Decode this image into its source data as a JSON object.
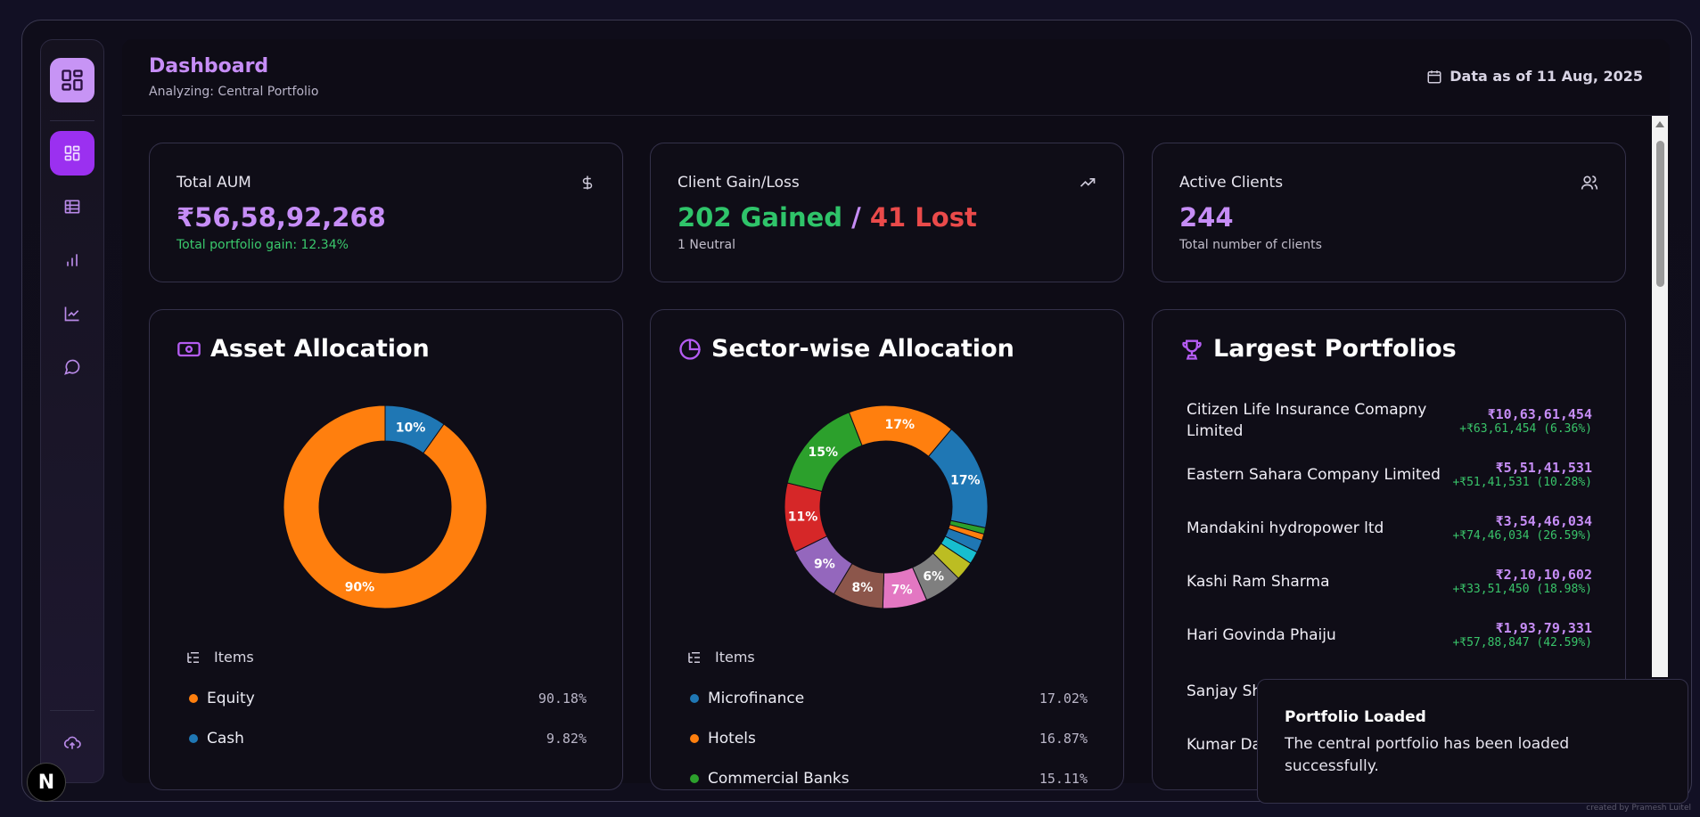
{
  "header": {
    "title": "Dashboard",
    "subtitle": "Analyzing: Central Portfolio",
    "date_label": "Data as of 11 Aug, 2025"
  },
  "sidebar": {
    "items": [
      {
        "icon": "dashboard-icon",
        "active": true
      },
      {
        "icon": "table-icon",
        "active": false
      },
      {
        "icon": "bar-chart-icon",
        "active": false
      },
      {
        "icon": "line-chart-icon",
        "active": false
      },
      {
        "icon": "chat-icon",
        "active": false
      },
      {
        "icon": "upload-cloud-icon",
        "active": false
      }
    ]
  },
  "stats": {
    "aum": {
      "label": "Total AUM",
      "value": "₹56,58,92,268",
      "sub": "Total portfolio gain: 12.34%"
    },
    "gainloss": {
      "label": "Client Gain/Loss",
      "gained": "202 Gained",
      "sep": "/",
      "lost": "41 Lost",
      "sub": "1 Neutral"
    },
    "clients": {
      "label": "Active Clients",
      "value": "244",
      "sub": "Total number of clients"
    }
  },
  "asset_allocation": {
    "title": "Asset Allocation",
    "legend_title": "Items",
    "items": [
      {
        "name": "Equity",
        "pct": "90.18%",
        "color": "#ff7f0e"
      },
      {
        "name": "Cash",
        "pct": "9.82%",
        "color": "#1f77b4"
      }
    ]
  },
  "sector_allocation": {
    "title": "Sector-wise Allocation",
    "legend_title": "Items",
    "items": [
      {
        "name": "Microfinance",
        "pct": "17.02%",
        "color": "#1f77b4"
      },
      {
        "name": "Hotels",
        "pct": "16.87%",
        "color": "#ff7f0e"
      },
      {
        "name": "Commercial Banks",
        "pct": "15.11%",
        "color": "#2ca02c"
      }
    ]
  },
  "chart_data": [
    {
      "type": "pie",
      "labels": [
        "Equity",
        "Cash"
      ],
      "values": [
        90.18,
        9.82
      ],
      "colors": [
        "#ff7f0e",
        "#1f77b4"
      ],
      "data_labels": [
        "90%",
        "10%"
      ]
    },
    {
      "type": "pie",
      "labels": [
        "Microfinance",
        "",
        "",
        "",
        "",
        "",
        "",
        "",
        "",
        "",
        "",
        "Commercial Banks",
        "Hotels"
      ],
      "values": [
        17.02,
        1,
        1,
        2,
        2,
        3,
        6,
        7,
        8,
        9,
        11,
        15.11,
        16.87
      ],
      "colors": [
        "#1f77b4",
        "#2ca02c",
        "#ff7f0e",
        "#1f77b4",
        "#17becf",
        "#bcbd22",
        "#7f7f7f",
        "#e377c2",
        "#8c564b",
        "#9467bd",
        "#d62728",
        "#2ca02c",
        "#ff7f0e"
      ],
      "data_labels": [
        "17%",
        "",
        "",
        "",
        "",
        "",
        "6%",
        "7%",
        "8%",
        "9%",
        "11%",
        "15%",
        "17%"
      ]
    }
  ],
  "largest_portfolios": {
    "title": "Largest Portfolios",
    "items": [
      {
        "name": "Citizen Life Insurance Comapny Limited",
        "amount": "₹10,63,61,454",
        "gain": "+₹63,61,454 (6.36%)"
      },
      {
        "name": "Eastern Sahara Company Limited",
        "amount": "₹5,51,41,531",
        "gain": "+₹51,41,531 (10.28%)"
      },
      {
        "name": "Mandakini hydropower ltd",
        "amount": "₹3,54,46,034",
        "gain": "+₹74,46,034 (26.59%)"
      },
      {
        "name": "Kashi Ram Sharma",
        "amount": "₹2,10,10,602",
        "gain": "+₹33,51,450 (18.98%)"
      },
      {
        "name": "Hari Govinda Phaiju",
        "amount": "₹1,93,79,331",
        "gain": "+₹57,88,847 (42.59%)"
      },
      {
        "name": "Sanjay Sh",
        "amount": "",
        "gain": ""
      },
      {
        "name": "Kumar Da",
        "amount": "",
        "gain": ""
      }
    ]
  },
  "toast": {
    "title": "Portfolio Loaded",
    "message": "The central portfolio has been loaded successfully."
  },
  "badge": "N",
  "credit": "created by Pramesh Luitel"
}
